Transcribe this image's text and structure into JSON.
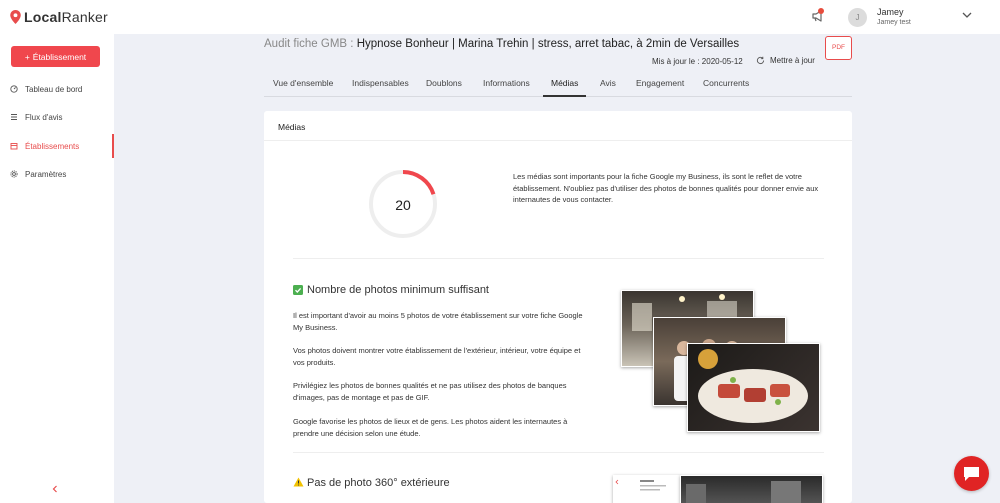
{
  "header": {
    "logo_bold": "Local",
    "logo_regular": "Ranker",
    "user_name": "Jamey",
    "user_sub": "Jamey test",
    "avatar_initial": "J"
  },
  "sidebar": {
    "add_button": "Établissement",
    "items": [
      {
        "label": "Tableau de bord",
        "icon": "dashboard-icon"
      },
      {
        "label": "Flux d'avis",
        "icon": "list-icon"
      },
      {
        "label": "Établissements",
        "icon": "store-icon",
        "active": true
      },
      {
        "label": "Paramètres",
        "icon": "gear-icon"
      }
    ]
  },
  "page": {
    "title_prefix": "Audit fiche GMB : ",
    "business_name": "Hypnose Bonheur | Marina Trehin | stress, arret tabac, à 2min de Versailles",
    "updated": "Mis à jour le : 2020-05-12",
    "refresh_label": "Mettre à jour",
    "pdf_label": "PDF"
  },
  "tabs": [
    "Vue d'ensemble",
    "Indispensables",
    "Doublons",
    "Informations",
    "Médias",
    "Avis",
    "Engagement",
    "Concurrents"
  ],
  "active_tab": "Médias",
  "card": {
    "title": "Médias",
    "score": "20",
    "score_fraction": 0.2,
    "intro": "Les médias sont importants pour la fiche Google my Business, ils sont le reflet de votre établissement. N'oubliez pas d'utiliser des photos de bonnes qualités pour donner envie aux internautes de vous contacter.",
    "section1": {
      "title": "Nombre de photos minimum suffisant",
      "status": "ok",
      "paragraphs": [
        "Il est important d'avoir au moins 5 photos de votre établissement sur votre fiche Google My Business.",
        "Vos photos doivent montrer votre établissement de l'extérieur, intérieur, votre équipe et vos produits.",
        "Privilégiez les photos de bonnes qualités et ne pas utilisez des photos de banques d'images, pas de montage et pas de GIF.",
        "Google favorise les photos de lieux et de gens. Les photos aident les internautes à prendre une décision selon une étude."
      ]
    },
    "section2": {
      "title": "Pas de photo 360° extérieure",
      "status": "warning"
    }
  },
  "colors": {
    "accent": "#f0474d",
    "success": "#4caf50",
    "warning": "#f2c200",
    "chat": "#e02424"
  }
}
